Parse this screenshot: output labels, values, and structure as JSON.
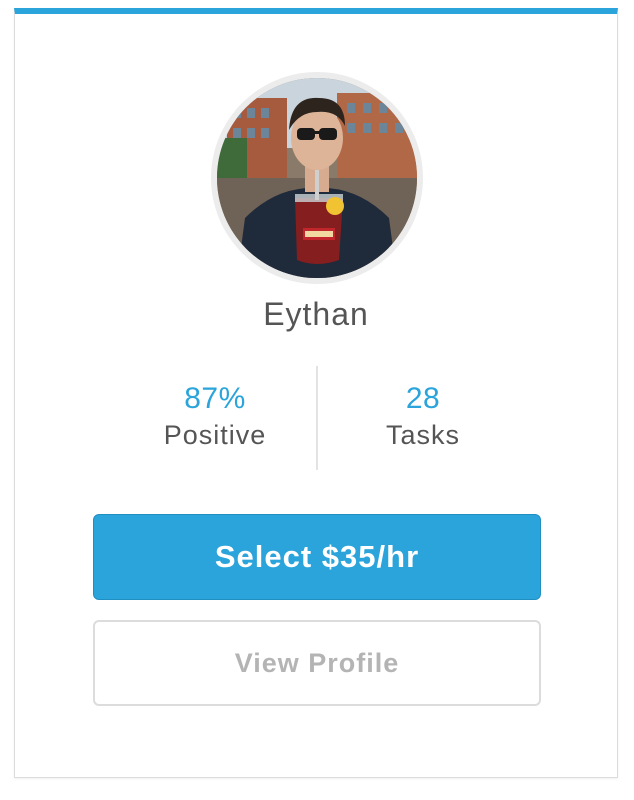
{
  "profile": {
    "name": "Eythan",
    "avatar_alt": "profile-photo"
  },
  "stats": [
    {
      "value": "87%",
      "label": "Positive"
    },
    {
      "value": "28",
      "label": "Tasks"
    }
  ],
  "actions": {
    "select_label": "Select $35/hr",
    "view_profile_label": "View Profile"
  },
  "colors": {
    "accent": "#2aa4da",
    "text": "#555555",
    "muted": "#b4b4b4",
    "border": "#dcdcdc"
  }
}
